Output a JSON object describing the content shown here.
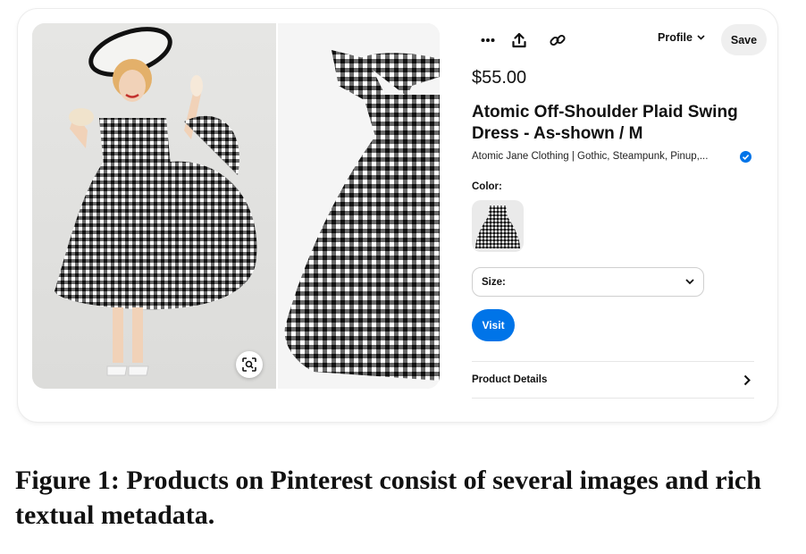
{
  "product": {
    "price": "$55.00",
    "title": "Atomic Off-Shoulder Plaid Swing Dress - As-shown / M",
    "merchant": "Atomic Jane Clothing | Gothic, Steampunk, Pinup,...",
    "color_label": "Color:",
    "size_label": "Size:",
    "visit_label": "Visit",
    "details_label": "Product Details"
  },
  "toolbar": {
    "more_icon": "more-icon",
    "share_icon": "share-icon",
    "link_icon": "link-icon",
    "profile_label": "Profile",
    "save_label": "Save"
  },
  "caption": "Figure 1: Products on Pinterest consist of several images and rich textual metadata.",
  "colors": {
    "accent": "#0074e8",
    "save_bg": "#efefef",
    "verified": "#0074e8"
  }
}
